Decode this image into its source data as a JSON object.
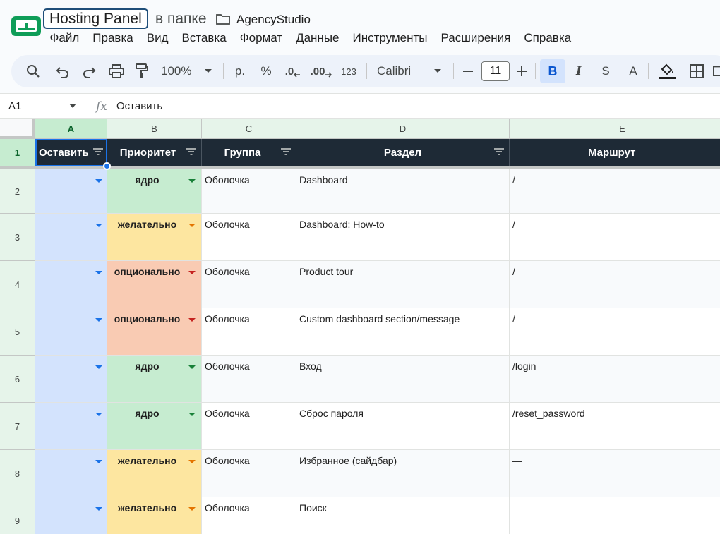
{
  "doc": {
    "title": "Hosting Panel",
    "in_folder": "в папке",
    "folder": "AgencyStudio"
  },
  "menu": [
    "Файл",
    "Правка",
    "Вид",
    "Вставка",
    "Формат",
    "Данные",
    "Инструменты",
    "Расширения",
    "Справка"
  ],
  "toolbar": {
    "zoom": "100%",
    "currency": "р.",
    "percent": "%",
    "dec_decrease": ".0",
    "dec_increase": ".00",
    "number_format": "123",
    "font": "Calibri",
    "font_size": "11",
    "bold": "B",
    "italic": "I",
    "strike": "S",
    "text_color": "A"
  },
  "formula_bar": {
    "cell_ref": "A1",
    "fx": "fx",
    "value": "Оставить"
  },
  "columns": [
    "A",
    "B",
    "C",
    "D",
    "E"
  ],
  "header_row": {
    "row_num": "1",
    "cells": [
      "Оставить",
      "Приоритет",
      "Группа",
      "Раздел",
      "Маршрут"
    ]
  },
  "rows": [
    {
      "num": "2",
      "priority": "ядро",
      "priority_type": "core",
      "group": "Оболочка",
      "section": "Dashboard",
      "route": "/"
    },
    {
      "num": "3",
      "priority": "желательно",
      "priority_type": "wish",
      "group": "Оболочка",
      "section": "Dashboard: How-to",
      "route": "/"
    },
    {
      "num": "4",
      "priority": "опционально",
      "priority_type": "opt",
      "group": "Оболочка",
      "section": "Product tour",
      "route": "/"
    },
    {
      "num": "5",
      "priority": "опционально",
      "priority_type": "opt",
      "group": "Оболочка",
      "section": "Custom dashboard section/message",
      "route": "/"
    },
    {
      "num": "6",
      "priority": "ядро",
      "priority_type": "core",
      "group": "Оболочка",
      "section": "Вход",
      "route": "/login"
    },
    {
      "num": "7",
      "priority": "ядро",
      "priority_type": "core",
      "group": "Оболочка",
      "section": "Сброс пароля",
      "route": "/reset_password"
    },
    {
      "num": "8",
      "priority": "желательно",
      "priority_type": "wish",
      "group": "Оболочка",
      "section": "Избранное (сайдбар)",
      "route": "—"
    },
    {
      "num": "9",
      "priority": "желательно",
      "priority_type": "wish",
      "group": "Оболочка",
      "section": "Поиск",
      "route": "—"
    }
  ],
  "colors": {
    "header_bg": "#1e2a36",
    "keep_col_bg": "#d3e3fd",
    "core_bg": "#c6ecd0",
    "wish_bg": "#fde6a0",
    "opt_bg": "#f9cbb3",
    "accent": "#1a73e8"
  }
}
